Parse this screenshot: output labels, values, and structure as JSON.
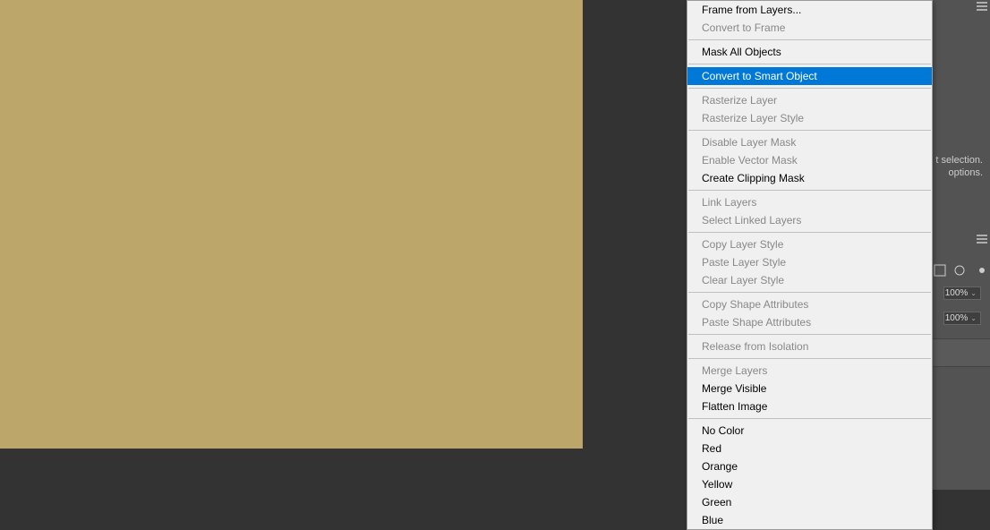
{
  "canvas": {
    "fill_color": "#bda66a"
  },
  "right_panel": {
    "hint_line1": "t selection.",
    "hint_line2": "options.",
    "opacity_label": "100%",
    "fill_label": "100%"
  },
  "context_menu": {
    "items": [
      {
        "label": "Frame from Layers...",
        "enabled": true
      },
      {
        "label": "Convert to Frame",
        "enabled": false
      },
      {
        "separator": true
      },
      {
        "label": "Mask All Objects",
        "enabled": true
      },
      {
        "separator": true
      },
      {
        "label": "Convert to Smart Object",
        "enabled": true,
        "highlighted": true
      },
      {
        "separator": true
      },
      {
        "label": "Rasterize Layer",
        "enabled": false
      },
      {
        "label": "Rasterize Layer Style",
        "enabled": false
      },
      {
        "separator": true
      },
      {
        "label": "Disable Layer Mask",
        "enabled": false
      },
      {
        "label": "Enable Vector Mask",
        "enabled": false
      },
      {
        "label": "Create Clipping Mask",
        "enabled": true
      },
      {
        "separator": true
      },
      {
        "label": "Link Layers",
        "enabled": false
      },
      {
        "label": "Select Linked Layers",
        "enabled": false
      },
      {
        "separator": true
      },
      {
        "label": "Copy Layer Style",
        "enabled": false
      },
      {
        "label": "Paste Layer Style",
        "enabled": false
      },
      {
        "label": "Clear Layer Style",
        "enabled": false
      },
      {
        "separator": true
      },
      {
        "label": "Copy Shape Attributes",
        "enabled": false
      },
      {
        "label": "Paste Shape Attributes",
        "enabled": false
      },
      {
        "separator": true
      },
      {
        "label": "Release from Isolation",
        "enabled": false
      },
      {
        "separator": true
      },
      {
        "label": "Merge Layers",
        "enabled": false
      },
      {
        "label": "Merge Visible",
        "enabled": true
      },
      {
        "label": "Flatten Image",
        "enabled": true
      },
      {
        "separator": true
      },
      {
        "label": "No Color",
        "enabled": true
      },
      {
        "label": "Red",
        "enabled": true
      },
      {
        "label": "Orange",
        "enabled": true
      },
      {
        "label": "Yellow",
        "enabled": true
      },
      {
        "label": "Green",
        "enabled": true
      },
      {
        "label": "Blue",
        "enabled": true
      }
    ]
  }
}
